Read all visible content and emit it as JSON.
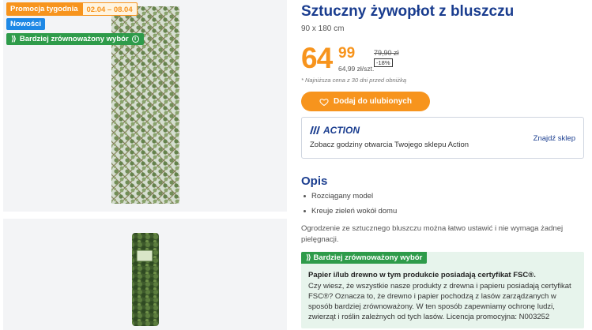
{
  "badges": {
    "promo_label": "Promocja tygodnia",
    "promo_dates": "02.04 – 08.04",
    "new_label": "Nowości",
    "eco_label": "Bardziej zrównoważony wybór"
  },
  "product": {
    "title": "Sztuczny żywopłot z bluszczu",
    "size": "90 x 180 cm",
    "price_int": "64",
    "price_dec": "99",
    "unit_price": "64,99 zł/szt.",
    "old_price": "79,90 zł",
    "discount": "-18%",
    "note": "* Najniższa cena z 30 dni przed obniżką",
    "favorite_button": "Dodaj do ulubionych"
  },
  "store": {
    "logo": "ACTION",
    "text": "Zobacz godziny otwarcia Twojego sklepu Action",
    "link": "Znajdź sklep"
  },
  "description": {
    "heading": "Opis",
    "bullets": [
      "Rozciągany model",
      "Kreuje zieleń wokół domu"
    ],
    "text": "Ogrodzenie ze sztucznego bluszczu można łatwo ustawić i nie wymaga żadnej pielęgnacji."
  },
  "eco_box": {
    "badge": "Bardziej zrównoważony wybór",
    "heading": "Papier i/lub drewno w tym produkcie posiadają certyfikat FSC®.",
    "body": "Czy wiesz, że wszystkie nasze produkty z drewna i papieru posiadają certyfikat FSC®? Oznacza to, że drewno i papier pochodzą z lasów zarządzanych w sposób bardziej zrównoważony. W ten sposób zapewniamy ochronę ludzi, zwierząt i roślin zależnych od tych lasów. Licencja promocyjna: N003252"
  },
  "colors": {
    "accent_orange": "#f7941d",
    "brand_blue": "#1a3d8f",
    "eco_green": "#2e9b4a",
    "new_blue": "#1e88e5"
  },
  "icons": {
    "heart": "heart-icon",
    "info": "info-icon",
    "leaf": "leaf-icon"
  }
}
